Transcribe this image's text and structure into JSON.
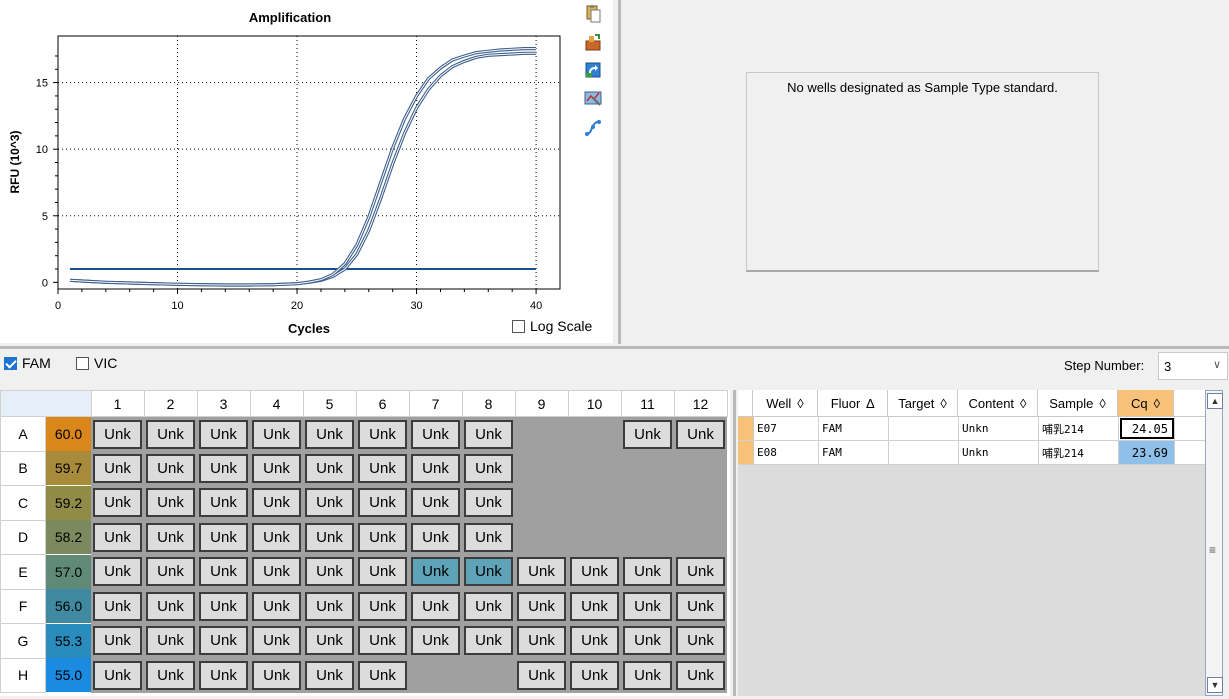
{
  "chart_data": {
    "type": "line",
    "title": "Amplification",
    "xlabel": "Cycles",
    "ylabel": "RFU (10^3)",
    "xlim": [
      0,
      42
    ],
    "ylim": [
      -0.5,
      18.5
    ],
    "xticks": [
      "0",
      "10",
      "20",
      "30",
      "40"
    ],
    "yticks": [
      "0",
      "5",
      "10",
      "15"
    ],
    "grid": true,
    "threshold": 1.0,
    "series": [
      {
        "well": "E07",
        "x": [
          1,
          2,
          4,
          6,
          8,
          10,
          12,
          14,
          16,
          18,
          20,
          21,
          22,
          23,
          24,
          25,
          26,
          27,
          28,
          29,
          30,
          31,
          32,
          33,
          34,
          35,
          36,
          37,
          38,
          39,
          40
        ],
        "y": [
          0.15,
          0.1,
          0.0,
          -0.05,
          -0.1,
          -0.15,
          -0.18,
          -0.2,
          -0.2,
          -0.18,
          -0.1,
          0.0,
          0.15,
          0.45,
          1.0,
          2.1,
          3.9,
          6.3,
          8.9,
          11.2,
          13.1,
          14.5,
          15.5,
          16.2,
          16.6,
          16.9,
          17.05,
          17.1,
          17.15,
          17.2,
          17.2
        ]
      },
      {
        "well": "E08",
        "x": [
          1,
          2,
          4,
          6,
          8,
          10,
          12,
          14,
          16,
          18,
          20,
          21,
          22,
          23,
          24,
          25,
          26,
          27,
          28,
          29,
          30,
          31,
          32,
          33,
          34,
          35,
          36,
          37,
          38,
          39,
          40
        ],
        "y": [
          0.15,
          0.1,
          0.0,
          -0.05,
          -0.1,
          -0.15,
          -0.18,
          -0.2,
          -0.2,
          -0.18,
          -0.1,
          0.02,
          0.2,
          0.6,
          1.4,
          2.8,
          4.9,
          7.5,
          10.1,
          12.3,
          14.0,
          15.3,
          16.1,
          16.7,
          17.0,
          17.25,
          17.35,
          17.45,
          17.5,
          17.55,
          17.55
        ]
      }
    ]
  },
  "chart_tools": [
    "copy-icon",
    "export-icon",
    "refresh-icon",
    "chart-settings-icon",
    "curve-fit-icon"
  ],
  "log_scale": {
    "label": "Log Scale",
    "checked": false
  },
  "standard_panel": {
    "message": "No wells designated as Sample Type standard."
  },
  "fluorophores": [
    {
      "label": "FAM",
      "checked": true
    },
    {
      "label": "VIC",
      "checked": false
    }
  ],
  "step": {
    "label": "Step Number:",
    "value": "3"
  },
  "plate": {
    "columns": [
      "1",
      "2",
      "3",
      "4",
      "5",
      "6",
      "7",
      "8",
      "9",
      "10",
      "11",
      "12"
    ],
    "rows": [
      {
        "label": "A",
        "temp": "60.0",
        "temp_color": "#d9861a",
        "wells": [
          "Unk",
          "Unk",
          "Unk",
          "Unk",
          "Unk",
          "Unk",
          "Unk",
          "Unk",
          "",
          "",
          "Unk",
          "Unk"
        ]
      },
      {
        "label": "B",
        "temp": "59.7",
        "temp_color": "#a78a3a",
        "wells": [
          "Unk",
          "Unk",
          "Unk",
          "Unk",
          "Unk",
          "Unk",
          "Unk",
          "Unk",
          "",
          "",
          "",
          ""
        ]
      },
      {
        "label": "C",
        "temp": "59.2",
        "temp_color": "#918b48",
        "wells": [
          "Unk",
          "Unk",
          "Unk",
          "Unk",
          "Unk",
          "Unk",
          "Unk",
          "Unk",
          "",
          "",
          "",
          ""
        ]
      },
      {
        "label": "D",
        "temp": "58.2",
        "temp_color": "#7b8a5e",
        "wells": [
          "Unk",
          "Unk",
          "Unk",
          "Unk",
          "Unk",
          "Unk",
          "Unk",
          "Unk",
          "",
          "",
          "",
          ""
        ]
      },
      {
        "label": "E",
        "temp": "57.0",
        "temp_color": "#5f8a78",
        "wells": [
          "Unk",
          "Unk",
          "Unk",
          "Unk",
          "Unk",
          "Unk",
          "Unk",
          "Unk",
          "Unk",
          "Unk",
          "Unk",
          "Unk"
        ]
      },
      {
        "label": "F",
        "temp": "56.0",
        "temp_color": "#3f8aa0",
        "wells": [
          "Unk",
          "Unk",
          "Unk",
          "Unk",
          "Unk",
          "Unk",
          "Unk",
          "Unk",
          "Unk",
          "Unk",
          "Unk",
          "Unk"
        ]
      },
      {
        "label": "G",
        "temp": "55.3",
        "temp_color": "#2a8bbd",
        "wells": [
          "Unk",
          "Unk",
          "Unk",
          "Unk",
          "Unk",
          "Unk",
          "Unk",
          "Unk",
          "Unk",
          "Unk",
          "Unk",
          "Unk"
        ]
      },
      {
        "label": "H",
        "temp": "55.0",
        "temp_color": "#1a8be0",
        "wells": [
          "Unk",
          "Unk",
          "Unk",
          "Unk",
          "Unk",
          "Unk",
          "",
          "",
          "Unk",
          "Unk",
          "Unk",
          "Unk"
        ]
      }
    ],
    "selected": [
      "E7",
      "E8"
    ]
  },
  "results": {
    "columns": [
      {
        "label": "Well",
        "sort": "◊"
      },
      {
        "label": "Fluor",
        "sort": "∆"
      },
      {
        "label": "Target",
        "sort": "◊"
      },
      {
        "label": "Content",
        "sort": "◊"
      },
      {
        "label": "Sample",
        "sort": "◊"
      },
      {
        "label": "Cq",
        "sort": "◊"
      }
    ],
    "rows": [
      {
        "well": "E07",
        "fluor": "FAM",
        "target": "",
        "content": "Unkn",
        "sample": "哺乳214",
        "cq": "24.05"
      },
      {
        "well": "E08",
        "fluor": "FAM",
        "target": "",
        "content": "Unkn",
        "sample": "哺乳214",
        "cq": "23.69"
      }
    ]
  }
}
